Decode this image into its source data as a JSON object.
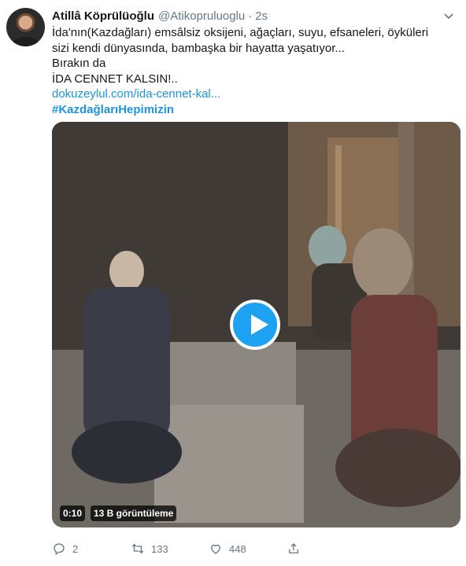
{
  "tweet": {
    "author_name": "Atillâ Köprülüoğlu",
    "handle": "@Atikopruluoglu",
    "separator": "·",
    "time": "2s",
    "lines": [
      "İda'nın(Kazdağları) emsâlsiz oksijeni, ağaçları, suyu, efsaneleri, öyküleri",
      "sizi kendi dünyasında, bambaşka bir hayatta yaşatıyor...",
      "Bırakın da",
      "İDA CENNET KALSIN!.."
    ],
    "link": "dokuzeylul.com/ida-cennet-kal...",
    "hashtag": "#KazdağlarıHepimizin"
  },
  "video": {
    "duration": "0:10",
    "views": "13 B görüntüleme"
  },
  "actions": {
    "reply_count": "2",
    "retweet_count": "133",
    "like_count": "448"
  },
  "colors": {
    "link": "#1b95e0",
    "play": "#1da1f2",
    "muted": "#657786"
  }
}
